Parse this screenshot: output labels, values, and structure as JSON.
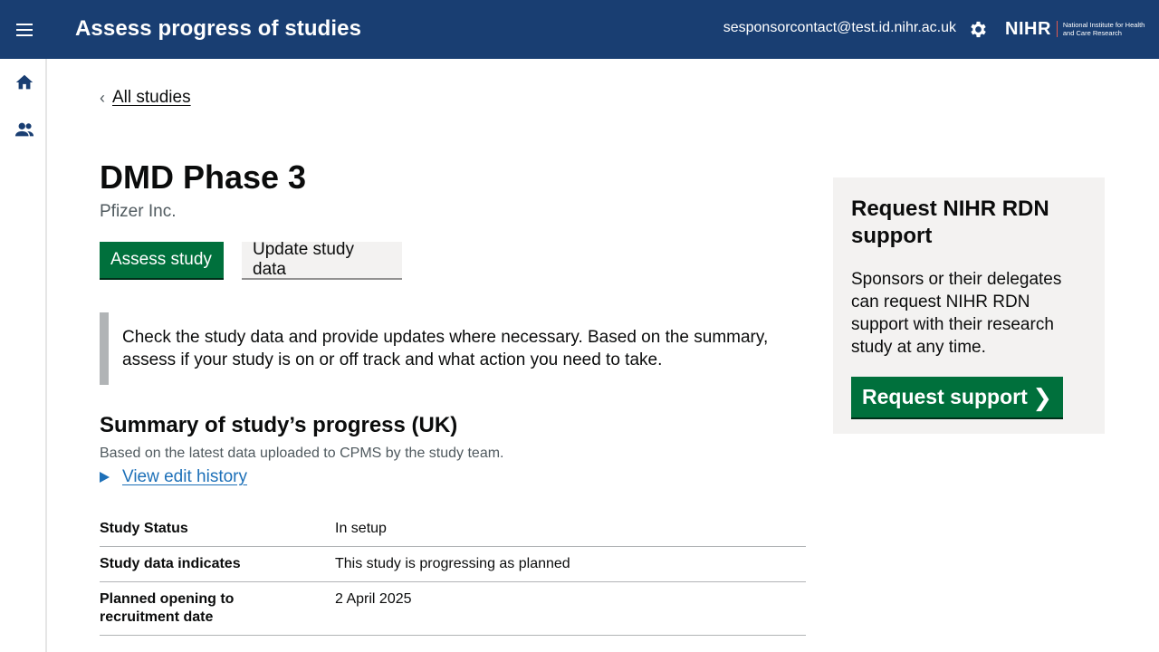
{
  "header": {
    "app_title": "Assess progress of studies",
    "user_email": "sesponsorcontact@test.id.nihr.ac.uk",
    "logo_main": "NIHR",
    "logo_sub": "National Institute for Health and Care Research",
    "brand_color": "#193e72"
  },
  "sidebar": {
    "items": [
      {
        "icon": "home-icon"
      },
      {
        "icon": "users-icon"
      }
    ]
  },
  "breadcrumb": {
    "back_label": "All studies"
  },
  "study": {
    "title": "DMD Phase 3",
    "organisation": "Pfizer Inc."
  },
  "actions": {
    "assess_label": "Assess study",
    "update_label": "Update study data"
  },
  "inset_text": "Check the study data and provide updates where necessary. Based on the summary, assess if your study is on or off track and what action you need to take.",
  "summary": {
    "heading": "Summary of study’s progress (UK)",
    "hint": "Based on the latest data uploaded to CPMS by the study team.",
    "history_link": "View edit history",
    "rows": [
      {
        "key": "Study Status",
        "value": "In setup"
      },
      {
        "key": "Study data indicates",
        "value": "This study is progressing as planned"
      },
      {
        "key": "Planned opening to recruitment date",
        "value": "2 April 2025"
      }
    ]
  },
  "support_panel": {
    "heading": "Request NIHR RDN support",
    "body": "Sponsors or their delegates can request NIHR RDN support with their research study at any time.",
    "button_label": "Request support"
  }
}
